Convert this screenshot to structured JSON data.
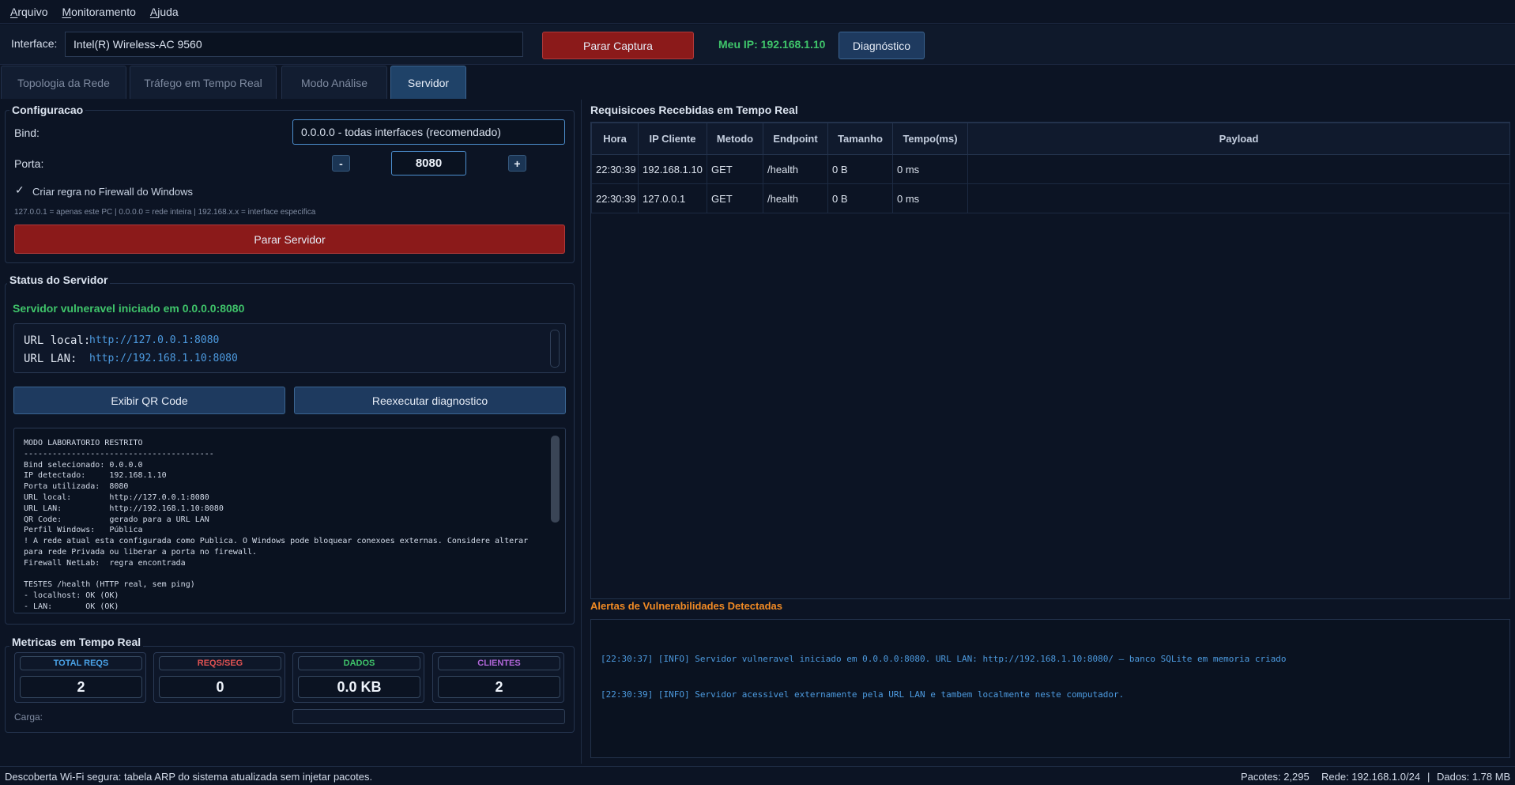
{
  "menu": {
    "items": [
      "Arquivo",
      "Monitoramento",
      "Ajuda"
    ]
  },
  "toolbar": {
    "interface_label": "Interface:",
    "interface_value": "Intel(R) Wireless-AC 9560",
    "stop_capture": "Parar Captura",
    "my_ip": "Meu IP: 192.168.1.10",
    "diagnostic": "Diagnóstico"
  },
  "tabs": [
    {
      "label": "Topologia da Rede",
      "active": false
    },
    {
      "label": "Tráfego em Tempo Real",
      "active": false
    },
    {
      "label": "Modo Análise",
      "active": false
    },
    {
      "label": "Servidor",
      "active": true
    }
  ],
  "config": {
    "title": "Configuracao",
    "bind_label": "Bind:",
    "bind_value": "0.0.0.0 - todas interfaces (recomendado)",
    "port_label": "Porta:",
    "port_minus": "-",
    "port_value": "8080",
    "port_plus": "+",
    "firewall_checkbox": "Criar regra no Firewall do Windows",
    "firewall_checked": true,
    "checkmark": "✓",
    "hint": "127.0.0.1 = apenas este PC | 0.0.0.0 = rede inteira | 192.168.x.x = interface especifica",
    "stop_server": "Parar Servidor"
  },
  "server_status": {
    "title": "Status do Servidor",
    "message": "Servidor vulneravel iniciado em 0.0.0.0:8080",
    "url_local_label": "URL local:",
    "url_local": "http://127.0.0.1:8080",
    "url_lan_label": "URL LAN:",
    "url_lan": "http://192.168.1.10:8080",
    "qr_button": "Exibir QR Code",
    "rerun_button": "Reexecutar diagnostico",
    "log_lines": [
      "MODO LABORATORIO RESTRITO",
      "----------------------------------------",
      "Bind selecionado: 0.0.0.0",
      "IP detectado:     192.168.1.10",
      "Porta utilizada:  8080",
      "URL local:        http://127.0.0.1:8080",
      "URL LAN:          http://192.168.1.10:8080",
      "QR Code:          gerado para a URL LAN",
      "Perfil Windows:   Pública",
      "! A rede atual esta configurada como Publica. O Windows pode bloquear conexoes externas. Considere alterar",
      "para rede Privada ou liberar a porta no firewall.",
      "Firewall NetLab:  regra encontrada",
      "",
      "TESTES /health (HTTP real, sem ping)",
      "- localhost: OK (OK)",
      "- LAN:       OK (OK)"
    ]
  },
  "metrics": {
    "title": "Metricas em Tempo Real",
    "items": [
      {
        "label": "TOTAL REQS",
        "value": "2",
        "color": "#4aa3e8"
      },
      {
        "label": "REQS/SEG",
        "value": "0",
        "color": "#e05252"
      },
      {
        "label": "DADOS",
        "value": "0.0 KB",
        "color": "#3fc46a"
      },
      {
        "label": "CLIENTES",
        "value": "2",
        "color": "#b066d8"
      }
    ],
    "load_label": "Carga:",
    "load_fraction": 0
  },
  "requests": {
    "title": "Requisicoes Recebidas em Tempo Real",
    "columns": [
      "Hora",
      "IP Cliente",
      "Metodo",
      "Endpoint",
      "Tamanho",
      "Tempo(ms)",
      "Payload"
    ],
    "rows": [
      [
        "22:30:39",
        "192.168.1.10",
        "GET",
        "/health",
        "0 B",
        "0 ms",
        ""
      ],
      [
        "22:30:39",
        "127.0.0.1",
        "GET",
        "/health",
        "0 B",
        "0 ms",
        ""
      ]
    ]
  },
  "alerts": {
    "title": "Alertas de Vulnerabilidades Detectadas",
    "lines": [
      "[22:30:37] [INFO] Servidor vulneravel iniciado em 0.0.0.0:8080. URL LAN: http://192.168.1.10:8080/ — banco SQLite em memoria criado",
      "[22:30:39] [INFO] Servidor acessivel externamente pela URL LAN e tambem localmente neste computador."
    ]
  },
  "statusbar": {
    "message": "Descoberta Wi-Fi segura: tabela ARP do sistema atualizada sem injetar pacotes.",
    "packets": "Pacotes: 2,295",
    "network": "Rede: 192.168.1.0/24",
    "separator": "|",
    "data": "Dados: 1.78 MB"
  },
  "colors": {
    "background": "#0c1424",
    "accent_blue": "#1f4268",
    "danger_red": "#8b1a1a",
    "success_green": "#3fc46a",
    "alert_orange": "#f08a24",
    "log_blue": "#4d9be0"
  }
}
